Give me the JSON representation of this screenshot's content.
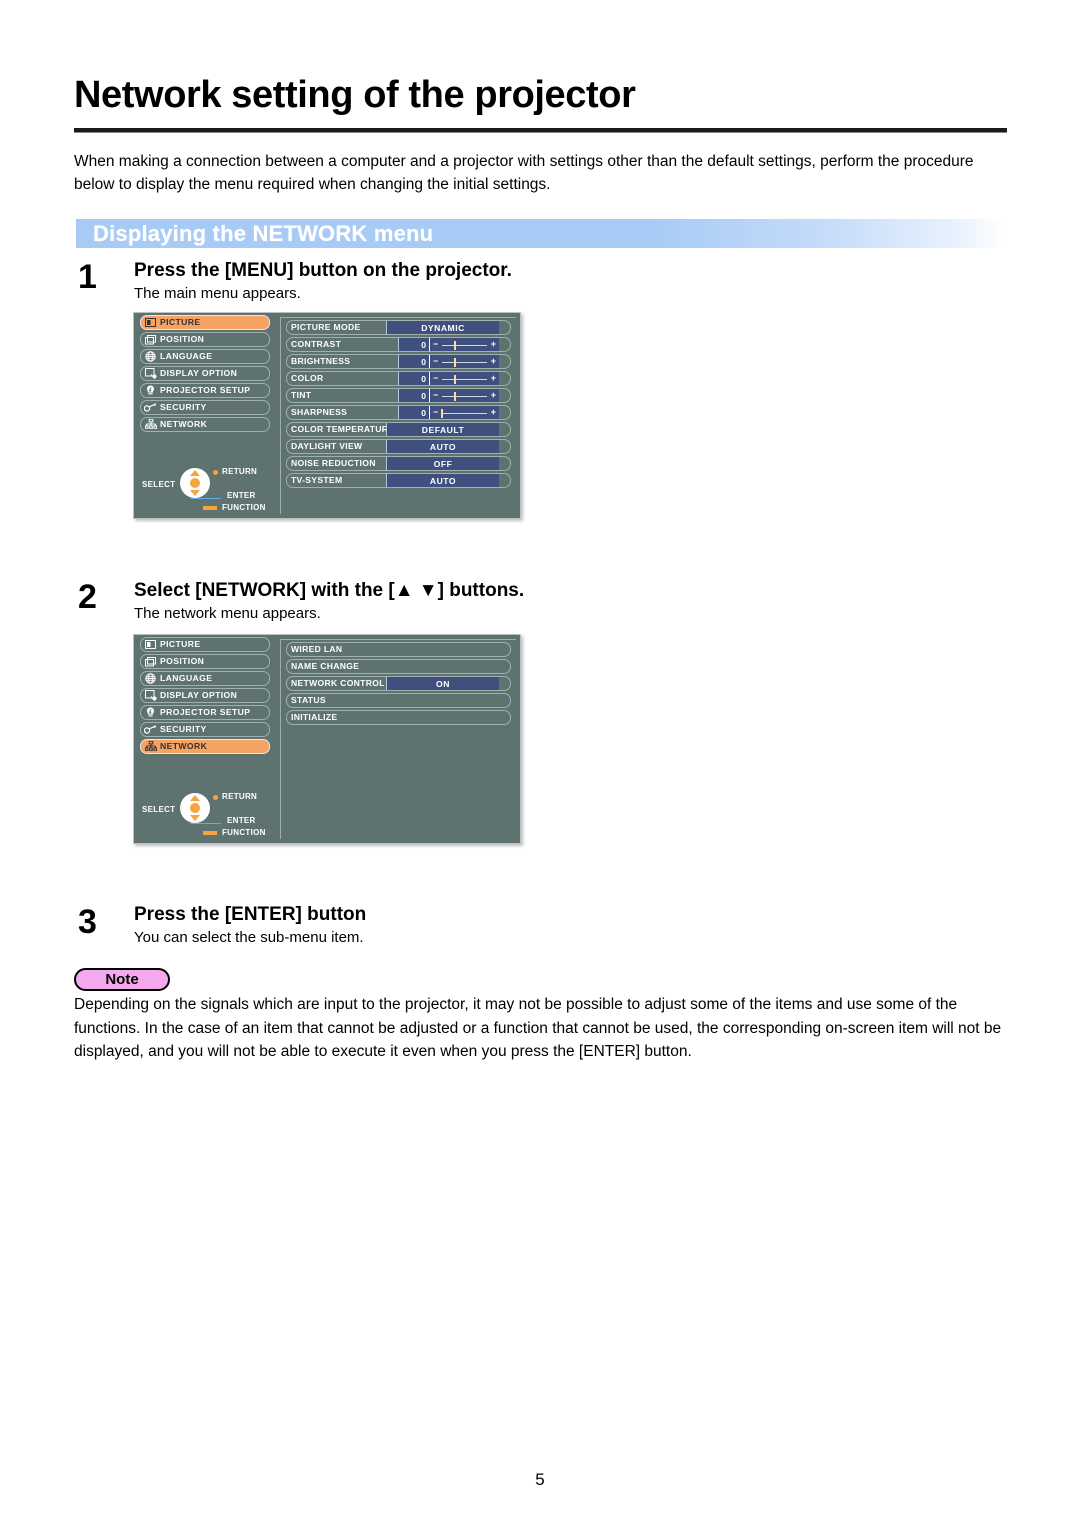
{
  "document": {
    "title": "Network setting of the projector",
    "intro": "When making a connection between a computer and a projector with settings other than the default settings, perform the procedure below to display the menu required when changing the initial settings.",
    "section_banner": "Displaying the NETWORK menu",
    "page_number": "5",
    "accent_banner_color": "#a8cbf5",
    "note_badge_color": "#f4a9ee",
    "osd_background_color": "#5e7270",
    "osd_highlight_color": "#f5a363",
    "osd_value_color": "#3f4f7e"
  },
  "steps": [
    {
      "number": "1",
      "title": "Press the [MENU] button on the projector.",
      "subtitle": "The main menu appears."
    },
    {
      "number": "2",
      "title": "Select [NETWORK] with the [▲ ▼] buttons.",
      "subtitle": "The network menu appears."
    },
    {
      "number": "3",
      "title": "Press the [ENTER] button",
      "subtitle": "You can select the sub-menu item."
    }
  ],
  "osd_nav": {
    "select": "SELECT",
    "return": "RETURN",
    "enter": "ENTER",
    "function": "FUNCTION"
  },
  "osd_menu_1": {
    "left_items": [
      {
        "label": "PICTURE",
        "icon": "picture-icon",
        "selected": true
      },
      {
        "label": "POSITION",
        "icon": "position-icon",
        "selected": false
      },
      {
        "label": "LANGUAGE",
        "icon": "globe-icon",
        "selected": false
      },
      {
        "label": "DISPLAY OPTION",
        "icon": "display-option-icon",
        "selected": false
      },
      {
        "label": "PROJECTOR SETUP",
        "icon": "projector-setup-icon",
        "selected": false
      },
      {
        "label": "SECURITY",
        "icon": "key-icon",
        "selected": false
      },
      {
        "label": "NETWORK",
        "icon": "network-icon",
        "selected": false
      }
    ],
    "right_items": [
      {
        "label": "PICTURE MODE",
        "value": "DYNAMIC",
        "kind": "value"
      },
      {
        "label": "CONTRAST",
        "value": "0",
        "kind": "slider",
        "thumb_percent": 50
      },
      {
        "label": "BRIGHTNESS",
        "value": "0",
        "kind": "slider",
        "thumb_percent": 50
      },
      {
        "label": "COLOR",
        "value": "0",
        "kind": "slider",
        "thumb_percent": 50
      },
      {
        "label": "TINT",
        "value": "0",
        "kind": "slider",
        "thumb_percent": 50
      },
      {
        "label": "SHARPNESS",
        "value": "0",
        "kind": "slider",
        "thumb_percent": 12
      },
      {
        "label": "COLOR TEMPERATURE",
        "value": "DEFAULT",
        "kind": "value"
      },
      {
        "label": "DAYLIGHT VIEW",
        "value": "AUTO",
        "kind": "value"
      },
      {
        "label": "NOISE REDUCTION",
        "value": "OFF",
        "kind": "value"
      },
      {
        "label": "TV-SYSTEM",
        "value": "AUTO",
        "kind": "value"
      }
    ]
  },
  "osd_menu_2": {
    "left_items": [
      {
        "label": "PICTURE",
        "icon": "picture-icon",
        "selected": false
      },
      {
        "label": "POSITION",
        "icon": "position-icon",
        "selected": false
      },
      {
        "label": "LANGUAGE",
        "icon": "globe-icon",
        "selected": false
      },
      {
        "label": "DISPLAY OPTION",
        "icon": "display-option-icon",
        "selected": false
      },
      {
        "label": "PROJECTOR SETUP",
        "icon": "projector-setup-icon",
        "selected": false
      },
      {
        "label": "SECURITY",
        "icon": "key-icon",
        "selected": false
      },
      {
        "label": "NETWORK",
        "icon": "network-icon",
        "selected": true
      }
    ],
    "right_items": [
      {
        "label": "WIRED LAN",
        "value": "",
        "kind": "plain"
      },
      {
        "label": "NAME CHANGE",
        "value": "",
        "kind": "plain"
      },
      {
        "label": "NETWORK CONTROL",
        "value": "ON",
        "kind": "value"
      },
      {
        "label": "STATUS",
        "value": "",
        "kind": "plain"
      },
      {
        "label": "INITIALIZE",
        "value": "",
        "kind": "plain"
      }
    ]
  },
  "note": {
    "label": "Note",
    "text": "Depending on the signals which are input to the projector, it may not be possible to adjust some of the items and use some of the functions. In the case of an item that cannot be adjusted or a function that cannot be used, the corresponding on-screen item will not be displayed, and you will not be able to execute it even when you press the [ENTER] button."
  }
}
